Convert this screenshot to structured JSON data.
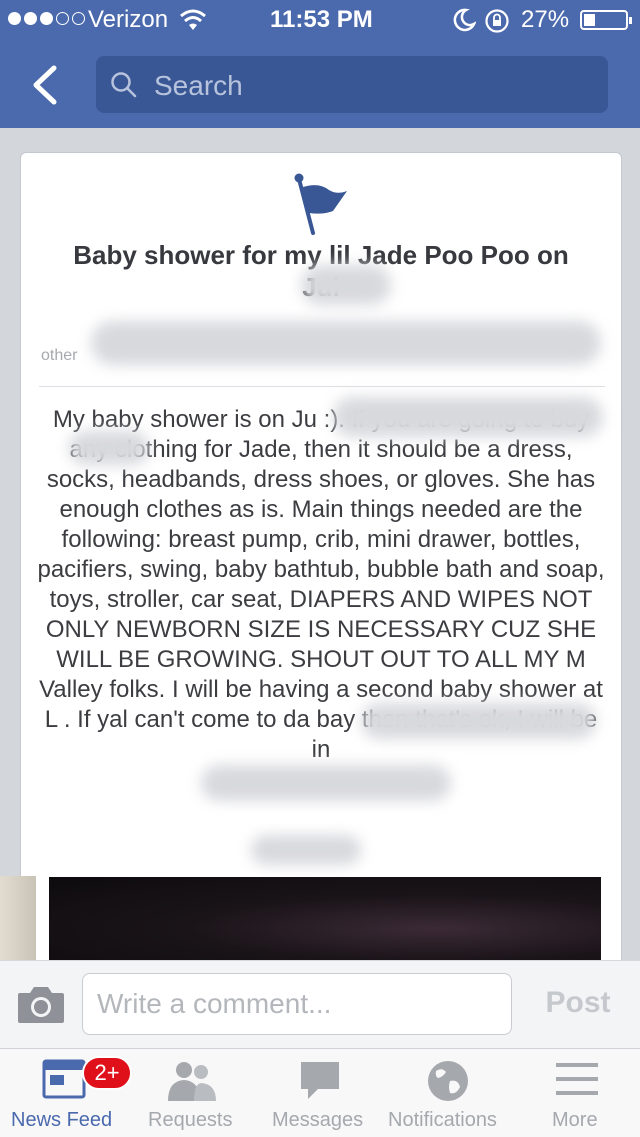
{
  "status_bar": {
    "carrier": "Verizon",
    "time": "11:53 PM",
    "battery_percent": "27%",
    "battery_level": 0.27
  },
  "nav": {
    "back_icon": "chevron-left-icon",
    "search_placeholder": "Search"
  },
  "event": {
    "title": "Baby shower for my lil Jade Poo Poo on Jul",
    "meta_visible": "other",
    "description": "My baby shower is on Ju                       :). If you are going to buy any clothing for Jade, then it should be a dress, socks, headbands, dress shoes, or gloves. She has enough clothes as is. Main things needed are the following: breast pump, crib, mini drawer, bottles, pacifiers, swing, baby bathtub, bubble bath and soap, toys, stroller, car seat, DIAPERS AND WIPES NOT ONLY NEWBORN SIZE IS NECESSARY CUZ SHE WILL BE GROWING. SHOUT OUT TO ALL MY M                     Valley folks. I will be having a second baby shower at L                          . If yal can't come to da bay then that's ok, I will be in"
  },
  "comment": {
    "placeholder": "Write a comment...",
    "post_label": "Post"
  },
  "tabs": [
    {
      "label": "News Feed",
      "icon": "news-feed-icon",
      "active": true,
      "badge": "2+"
    },
    {
      "label": "Requests",
      "icon": "friend-requests-icon",
      "active": false
    },
    {
      "label": "Messages",
      "icon": "messages-icon",
      "active": false
    },
    {
      "label": "Notifications",
      "icon": "globe-icon",
      "active": false
    },
    {
      "label": "More",
      "icon": "menu-icon",
      "active": false
    }
  ],
  "colors": {
    "brand_blue": "#4b6aad",
    "badge_red": "#e0101a"
  }
}
